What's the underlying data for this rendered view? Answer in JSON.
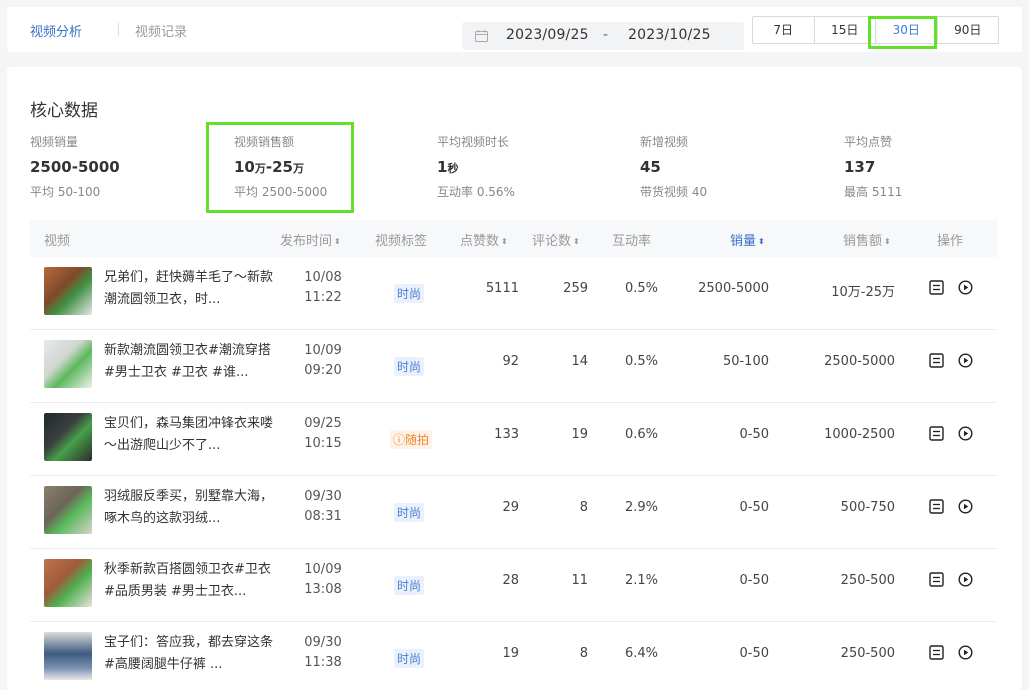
{
  "tabs": [
    {
      "label": "视频分析"
    },
    {
      "label": "视频记录"
    }
  ],
  "date_range": {
    "start": "2023/09/25",
    "separator": "-",
    "end": "2023/10/25"
  },
  "range_buttons": [
    {
      "label": "7日"
    },
    {
      "label": "15日"
    },
    {
      "label": "30日"
    },
    {
      "label": "90日"
    }
  ],
  "section_title": "核心数据",
  "metrics": [
    {
      "label": "视频销量",
      "value": "2500-5000",
      "sub": "平均 50-100"
    },
    {
      "label": "视频销售额",
      "value_num1": "10",
      "value_unit1": "万",
      "value_mid": "-",
      "value_num2": "25",
      "value_unit2": "万",
      "sub": "平均 2500-5000"
    },
    {
      "label": "平均视频时长",
      "value_num": "1",
      "value_unit": "秒",
      "sub": "互动率 0.56%"
    },
    {
      "label": "新增视频",
      "value": "45",
      "sub": "带货视频 40"
    },
    {
      "label": "平均点赞",
      "value": "137",
      "sub": "最高 5111"
    }
  ],
  "table": {
    "headers": {
      "video": "视频",
      "publish_time": "发布时间",
      "video_tag": "视频标签",
      "likes": "点赞数",
      "comments": "评论数",
      "engagement": "互动率",
      "sales": "销量",
      "revenue": "销售额",
      "actions": "操作"
    },
    "rows": [
      {
        "title": "兄弟们，赶快薅羊毛了～新款潮流圆领卫衣，时...",
        "date": "10/08",
        "time": "11:22",
        "tag": "时尚",
        "likes": "5111",
        "comments": "259",
        "engagement": "0.5%",
        "sales": "2500-5000",
        "revenue": "10万-25万"
      },
      {
        "title": "新款潮流圆领卫衣#潮流穿搭 #男士卫衣 #卫衣 #谁...",
        "date": "10/09",
        "time": "09:20",
        "tag": "时尚",
        "likes": "92",
        "comments": "14",
        "engagement": "0.5%",
        "sales": "50-100",
        "revenue": "2500-5000"
      },
      {
        "title": "宝贝们，森马集团冲锋衣来喽～出游爬山少不了...",
        "date": "09/25",
        "time": "10:15",
        "tag": "随拍",
        "likes": "133",
        "comments": "19",
        "engagement": "0.6%",
        "sales": "0-50",
        "revenue": "1000-2500"
      },
      {
        "title": "羽绒服反季买，别墅靠大海，啄木鸟的这款羽绒...",
        "date": "09/30",
        "time": "08:31",
        "tag": "时尚",
        "likes": "29",
        "comments": "8",
        "engagement": "2.9%",
        "sales": "0-50",
        "revenue": "500-750"
      },
      {
        "title": "秋季新款百搭圆领卫衣#卫衣 #品质男装 #男士卫衣...",
        "date": "10/09",
        "time": "13:08",
        "tag": "时尚",
        "likes": "28",
        "comments": "11",
        "engagement": "2.1%",
        "sales": "0-50",
        "revenue": "250-500"
      },
      {
        "title": "宝子们：答应我，都去穿这条#高腰阔腿牛仔裤 ...",
        "date": "09/30",
        "time": "11:38",
        "tag": "时尚",
        "likes": "19",
        "comments": "8",
        "engagement": "6.4%",
        "sales": "0-50",
        "revenue": "250-500"
      }
    ]
  },
  "colors": {
    "accent": "#3a6fc9",
    "highlight": "#62e02a",
    "tag_fashion_bg": "#eaf1fd",
    "tag_casual": "#f08a2c"
  }
}
